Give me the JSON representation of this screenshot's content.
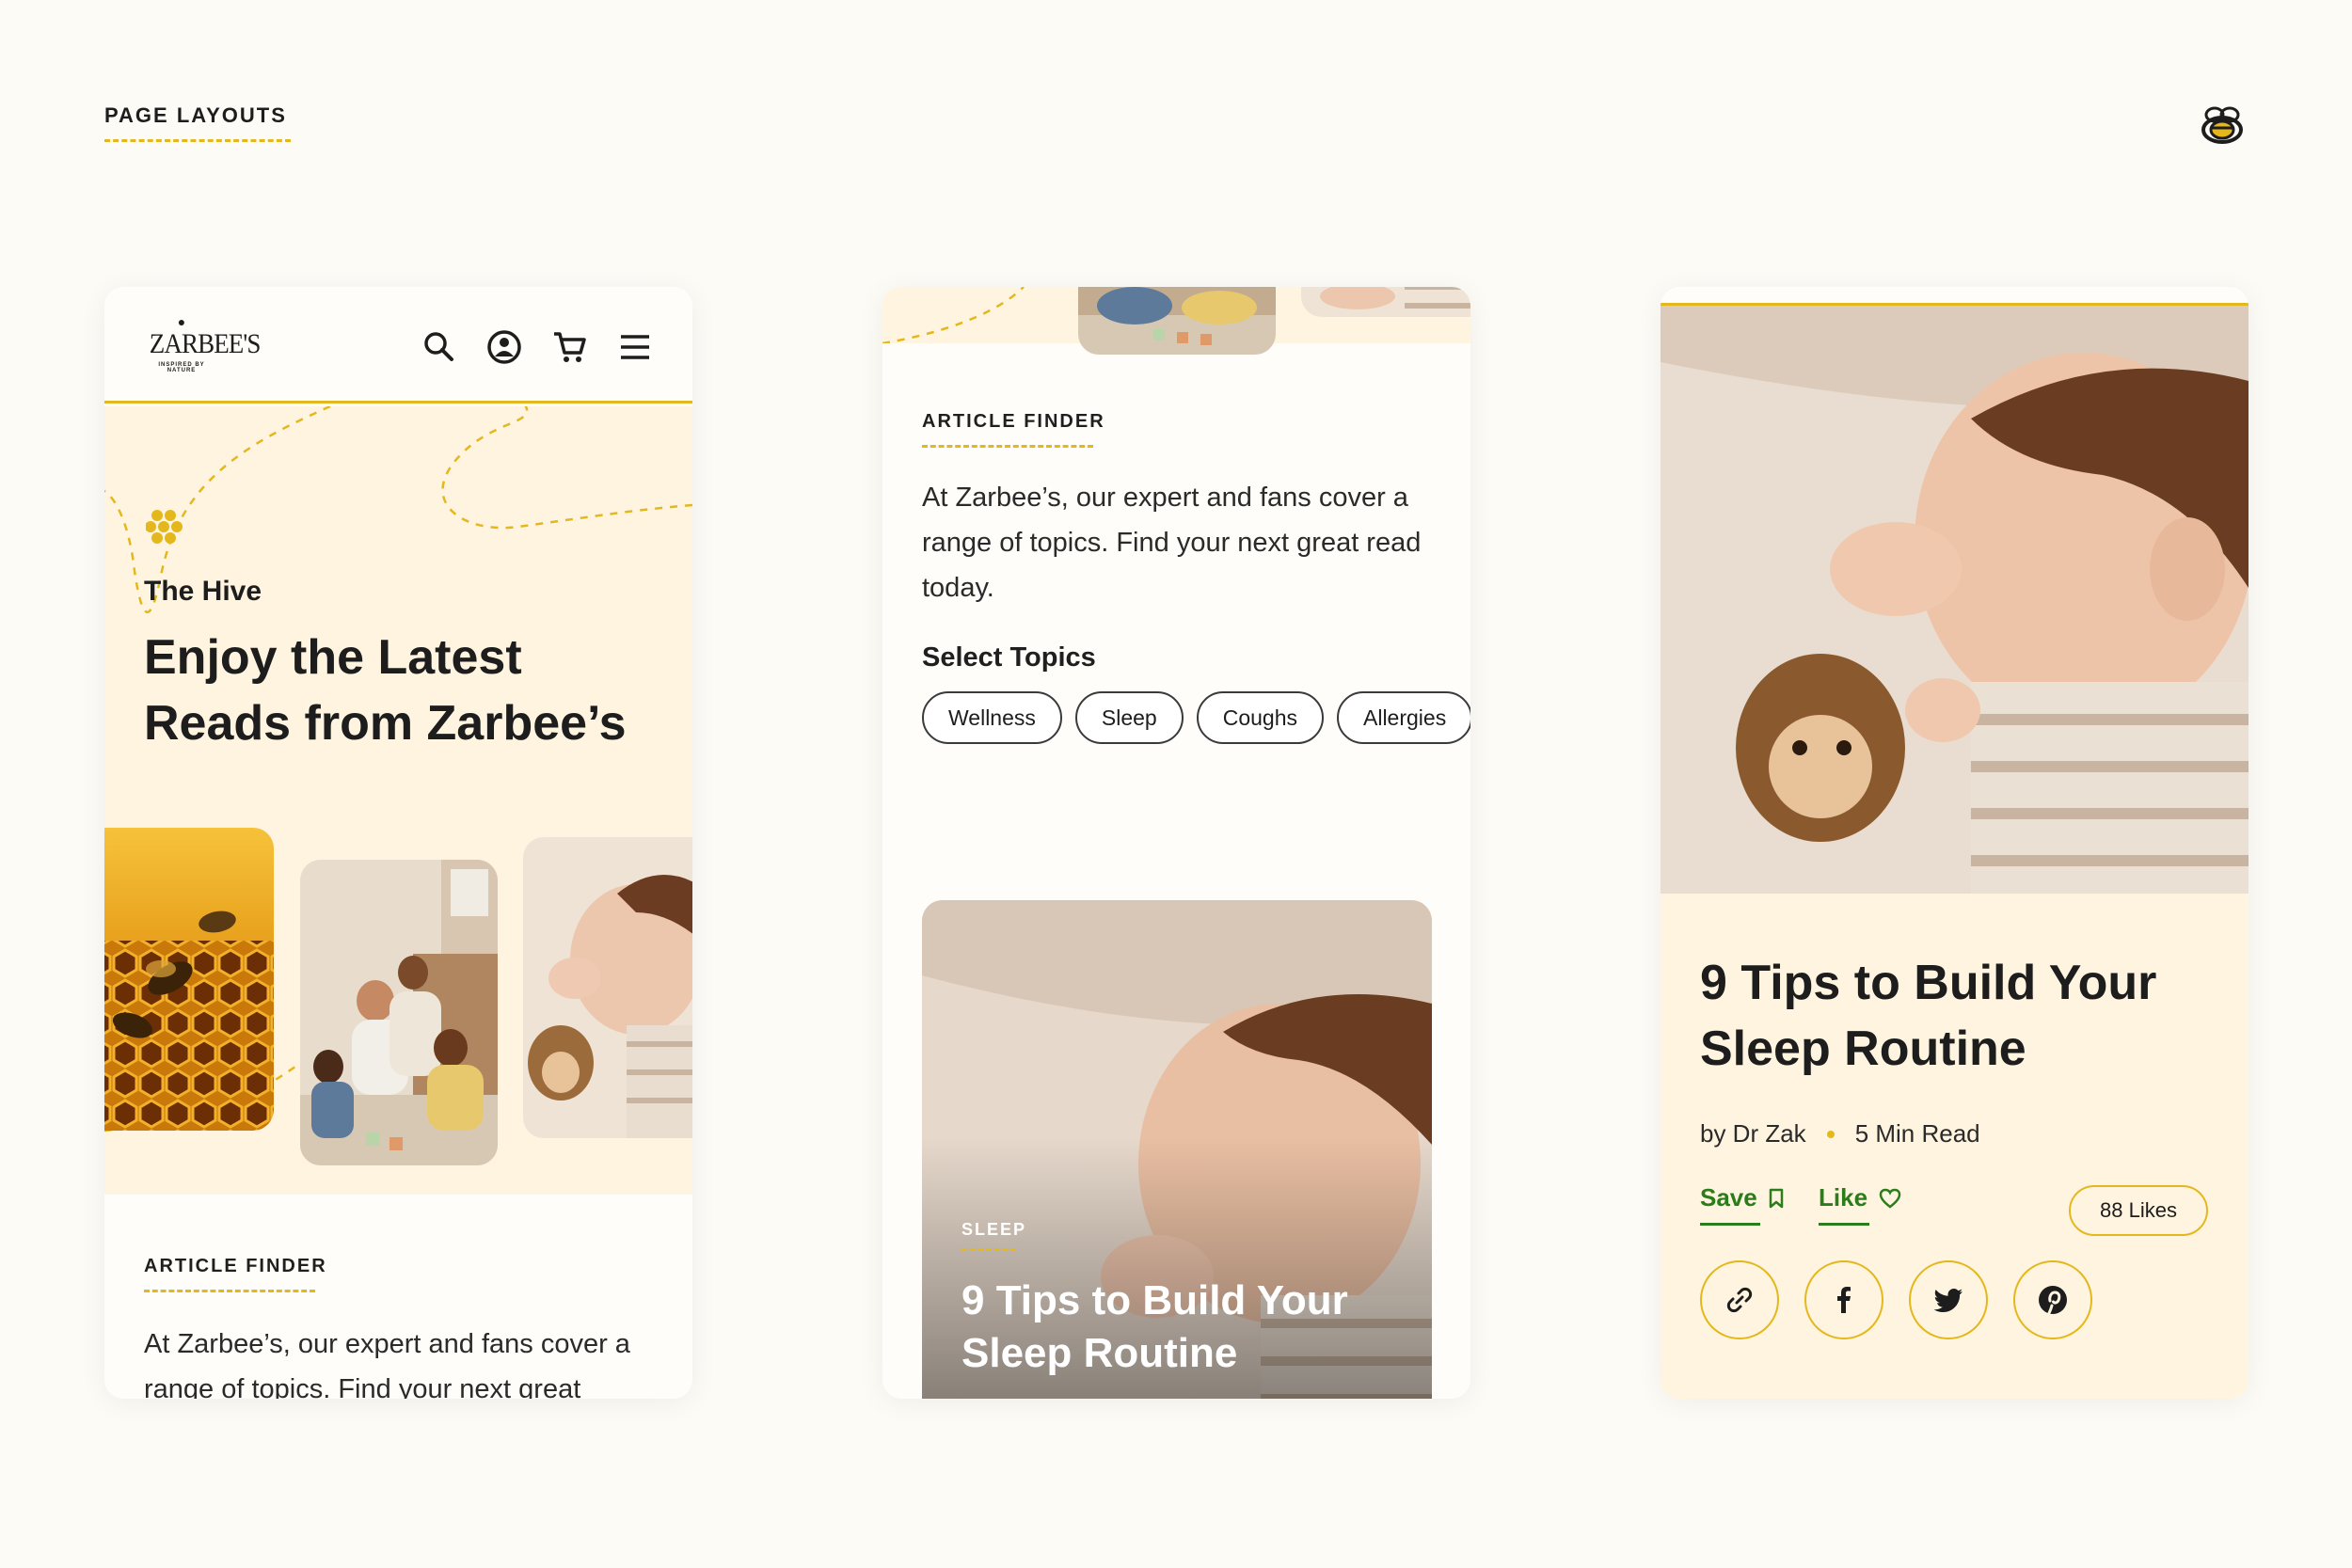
{
  "page": {
    "section_label": "PAGE LAYOUTS",
    "brand_mark_icon": "bee-icon",
    "accent_color": "#e4b81c",
    "hero_bg_color": "#fff4df",
    "action_color": "#2a7d1a"
  },
  "brand": {
    "wordmark": "ZARBEE'S",
    "tagline": "INSPIRED BY NATURE"
  },
  "header": {
    "icons": [
      "search-icon",
      "account-icon",
      "cart-icon",
      "menu-icon"
    ]
  },
  "hero": {
    "kicker": "The Hive",
    "title": "Enjoy the Latest Reads from Zarbee’s"
  },
  "article_finder": {
    "label": "ARTICLE FINDER",
    "description": "At Zarbee’s, our expert and fans cover a range of topics. Find your next great read today.",
    "description_truncated": "At Zarbee’s, our expert and fans cover a range of topics. Find your next great",
    "topics_label": "Select Topics",
    "topics": [
      "Wellness",
      "Sleep",
      "Coughs",
      "Allergies"
    ]
  },
  "featured_article": {
    "category": "SLEEP",
    "title": "9 Tips to Build Your Sleep Routine"
  },
  "article_detail": {
    "title": "9 Tips to Build Your Sleep Routine",
    "author": "by Dr Zak",
    "read_time": "5 Min Read",
    "save_label": "Save",
    "like_label": "Like",
    "likes": "88 Likes",
    "share_icons": [
      "link-icon",
      "facebook-icon",
      "twitter-icon",
      "pinterest-icon"
    ]
  }
}
